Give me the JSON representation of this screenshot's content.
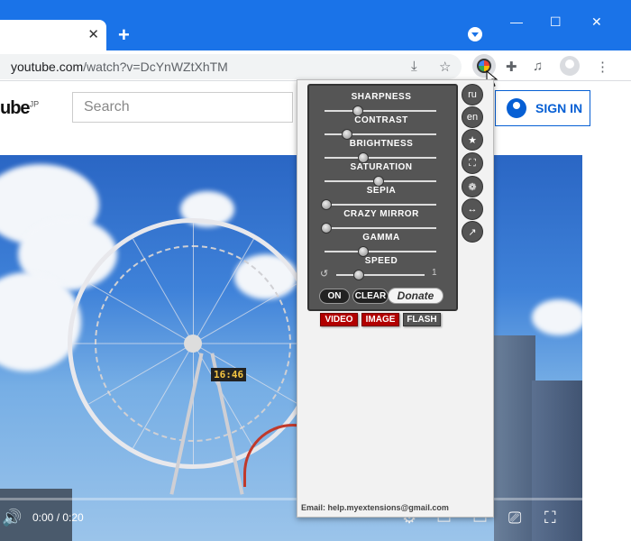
{
  "browser": {
    "tab_close": "✕",
    "new_tab": "+",
    "tab_search_icon": "tab-search-icon",
    "window": {
      "minimize": "—",
      "maximize": "☐",
      "close": "✕"
    },
    "url_host": "youtube.com",
    "url_rest": "/watch?v=DcYnWZtXhTM",
    "install_icon": "⤓",
    "star_icon": "☆",
    "puzzle_icon": "✚",
    "media_icon": "♫",
    "menu_icon": "⋮"
  },
  "youtube": {
    "logo": "ube",
    "logo_region": "JP",
    "search_placeholder": "Search",
    "sign_in": "SIGN IN",
    "time": "0:00 / 0:20",
    "clock_text": "16:46",
    "volume_icon": "🔊",
    "settings_icon": "⚙",
    "miniplayer_icon": "▭",
    "theater_icon": "▭",
    "cast_icon": "⎚",
    "fullscreen_icon": "⛶"
  },
  "popup": {
    "sliders": [
      {
        "label": "SHARPNESS",
        "level": 0.3
      },
      {
        "label": "CONTRAST",
        "level": 0.2
      },
      {
        "label": "BRIGHTNESS",
        "level": 0.35
      },
      {
        "label": "SATURATION",
        "level": 0.5
      },
      {
        "label": "SEPIA",
        "level": 0.0
      },
      {
        "label": "CRAZY MIRROR",
        "level": 0.0
      },
      {
        "label": "GAMMA",
        "level": 0.35
      },
      {
        "label": "SPEED",
        "level": 0.25
      }
    ],
    "reset_icon": "↺",
    "speed_value": "1",
    "on_label": "ON",
    "clear_label": "CLEAR",
    "donate_label": "Donate",
    "modes": {
      "video": "VIDEO",
      "image": "IMAGE",
      "flash": "FLASH"
    },
    "side_buttons": [
      "ru",
      "en",
      "★",
      "⛶",
      "❁",
      "↔",
      "↗"
    ],
    "email": "Email:  help.myextensions@gmail.com"
  }
}
